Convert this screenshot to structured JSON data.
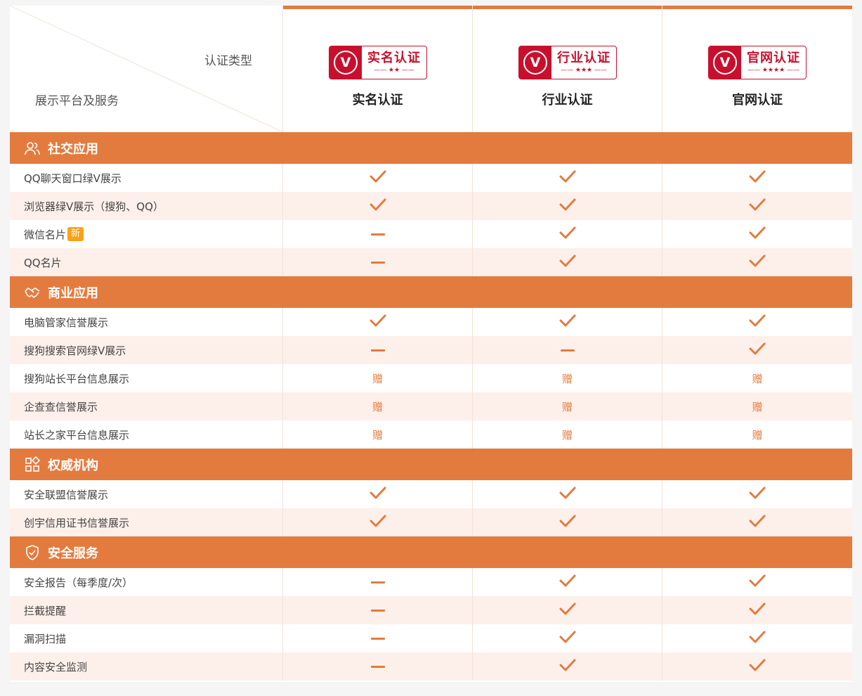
{
  "header": {
    "diag_top": "认证类型",
    "diag_bottom": "展示平台及服务",
    "columns": [
      {
        "badge_name": "实名认证",
        "badge_stars": "—— ★★ ——",
        "title": "实名认证"
      },
      {
        "badge_name": "行业认证",
        "badge_stars": "—— ★★★ ——",
        "title": "行业认证"
      },
      {
        "badge_name": "官网认证",
        "badge_stars": "—— ★★★★ ——",
        "title": "官网认证"
      }
    ],
    "badge_letter": "V"
  },
  "sections": [
    {
      "label": "社交应用",
      "icon": "users-icon"
    },
    {
      "label": "商业应用",
      "icon": "handshake-icon"
    },
    {
      "label": "权威机构",
      "icon": "apps-icon"
    },
    {
      "label": "安全服务",
      "icon": "shield-check-icon"
    }
  ],
  "rows": [
    {
      "name": "QQ聊天窗口绿V展示",
      "values": [
        "check",
        "check",
        "check"
      ]
    },
    {
      "name": "浏览器绿V展示（搜狗、QQ）",
      "values": [
        "check",
        "check",
        "check"
      ]
    },
    {
      "name": "微信名片",
      "tag": "新",
      "values": [
        "dash",
        "check",
        "check"
      ]
    },
    {
      "name": "QQ名片",
      "values": [
        "dash",
        "check",
        "check"
      ]
    },
    {
      "name": "电脑管家信誉展示",
      "values": [
        "check",
        "check",
        "check"
      ]
    },
    {
      "name": "搜狗搜索官网绿V展示",
      "values": [
        "dash",
        "dash",
        "check"
      ]
    },
    {
      "name": "搜狗站长平台信息展示",
      "values": [
        "赠",
        "赠",
        "赠"
      ]
    },
    {
      "name": "企查查信誉展示",
      "values": [
        "赠",
        "赠",
        "赠"
      ]
    },
    {
      "name": "站长之家平台信息展示",
      "values": [
        "赠",
        "赠",
        "赠"
      ]
    },
    {
      "name": "安全联盟信誉展示",
      "values": [
        "check",
        "check",
        "check"
      ]
    },
    {
      "name": "创宇信用证书信誉展示",
      "values": [
        "check",
        "check",
        "check"
      ]
    },
    {
      "name": "安全报告（每季度/次）",
      "values": [
        "dash",
        "check",
        "check"
      ]
    },
    {
      "name": "拦截提醒",
      "values": [
        "dash",
        "check",
        "check"
      ]
    },
    {
      "name": "漏洞扫描",
      "values": [
        "dash",
        "check",
        "check"
      ]
    },
    {
      "name": "内容安全监测",
      "values": [
        "dash",
        "check",
        "check"
      ]
    }
  ],
  "colors": {
    "accent": "#e37b3f",
    "badge_red": "#c8102e",
    "alt_row": "#fdf0ea",
    "new_tag": "#f7a21b"
  }
}
